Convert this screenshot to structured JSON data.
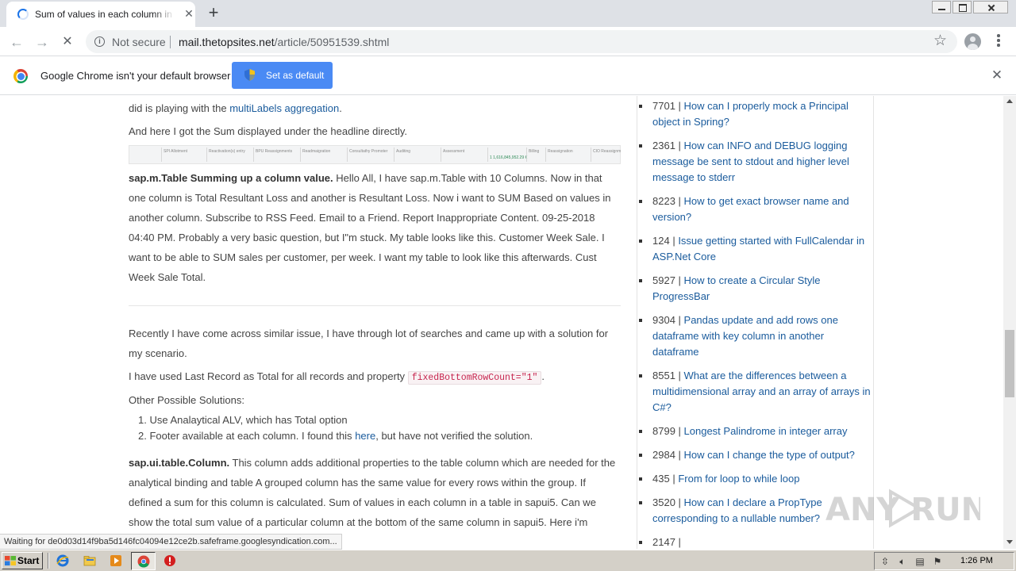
{
  "browser": {
    "tab_title": "Sum of values in each column in a table in sapui5",
    "not_secure_label": "Not secure",
    "url_host": "mail.thetopsites.net",
    "url_path": "/article/50951539.shtml"
  },
  "infobar": {
    "message": "Google Chrome isn't your default browser",
    "button_label": "Set as default"
  },
  "article": {
    "p1_text": "did is playing with the ",
    "p1_link": "multiLabels aggregation",
    "p1_end": ".",
    "p2": "And here I got the Sum displayed under the headline directly.",
    "screenshot_cells": [
      "SPI Allotment",
      "Reactivation(s) entry",
      "BPU Reassignments",
      "Readmaigration",
      "Consultathy Promoter",
      "Auditing",
      "Assessment",
      "1 1,616,845,952.29 €",
      "Billing",
      "Reassignation",
      "CIO Reassignment"
    ],
    "p3_bold": "sap.m.Table Summing up a column value.",
    "p3_text": " Hello All, I have sap.m.Table with 10 Columns. Now in that one column is Total Resultant Loss and another is Resultant Loss. Now i want to  SUM Based on values in another column. Subscribe to RSS Feed. Email to a Friend. Report Inappropriate Content. 09-25-2018 04:40 PM. Probably a very basic question, but I\"m stuck. My table looks like this. Customer Week Sale. I want to be able to SUM sales per customer, per week. I want my table to look like this afterwards. Cust Week Sale Total.",
    "p4": "Recently I have come across similar issue, I have through lot of searches and came up with a solution for my scenario.",
    "p5_text": "I have used Last Record as Total for all records and property ",
    "p5_code": "fixedBottomRowCount=\"1\"",
    "p5_end": ".",
    "p6": "Other Possible Solutions:",
    "list": [
      {
        "num": "1.",
        "text": "Use Analaytical ALV, which has Total option",
        "link": "",
        "end": ""
      },
      {
        "num": "2.",
        "text": "Footer available at each column. I found this ",
        "link": "here",
        "end": ", but have not verified the solution."
      }
    ],
    "p7_bold": "sap.ui.table.Column.",
    "p7_text": " This column adds additional properties to the table column which are needed for the analytical binding and table A grouped column has the same value for every rows within the group. If defined a sum for this column is calculated. Sum of values in each column in a table in sapui5. Can we show the total sum value of a particular column at the bottom of the same column in sapui5. Here i'm"
  },
  "sidebar": {
    "items": [
      {
        "count": "7701",
        "title": "How can I properly mock a Principal object in Spring?"
      },
      {
        "count": "2361",
        "title": "How can INFO and DEBUG logging message be sent to stdout and higher level message to stderr"
      },
      {
        "count": "8223",
        "title": "How to get exact browser name and version?"
      },
      {
        "count": "124",
        "title": "Issue getting started with FullCalendar in ASP.Net Core"
      },
      {
        "count": "5927",
        "title": "How to create a Circular Style ProgressBar"
      },
      {
        "count": "9304",
        "title": "Pandas update and add rows one dataframe with key column in another dataframe"
      },
      {
        "count": "8551",
        "title": "What are the differences between a multidimensional array and an array of arrays in C#?"
      },
      {
        "count": "8799",
        "title": "Longest Palindrome in integer array"
      },
      {
        "count": "2984",
        "title": "How can I change the type of output?"
      },
      {
        "count": "435",
        "title": "From for loop to while loop"
      },
      {
        "count": "3520",
        "title": "How can I declare a PropType corresponding to a nullable number?"
      },
      {
        "count": "2147",
        "title": ""
      }
    ]
  },
  "status_bar_text": "Waiting for de0d03d14f9ba5d146fc04094e12ce2b.safeframe.googlesyndication.com...",
  "watermark_text": "ANY RUN",
  "taskbar": {
    "start_label": "Start",
    "clock": "1:26 PM"
  },
  "icons": [
    "loading-spinner",
    "close-icon",
    "plus-icon",
    "back-arrow",
    "forward-arrow",
    "stop-icon",
    "info-icon",
    "star-icon",
    "profile-icon",
    "menu-icon",
    "chrome-logo",
    "shield-icon",
    "windows-logo",
    "ie-icon",
    "folder-icon",
    "media-player-icon",
    "chrome-icon",
    "stop-sign-icon"
  ],
  "colors": {
    "link": "#1a5b9c",
    "set_default_button": "#4a8af4",
    "taskbar": "#d4d0c8"
  }
}
